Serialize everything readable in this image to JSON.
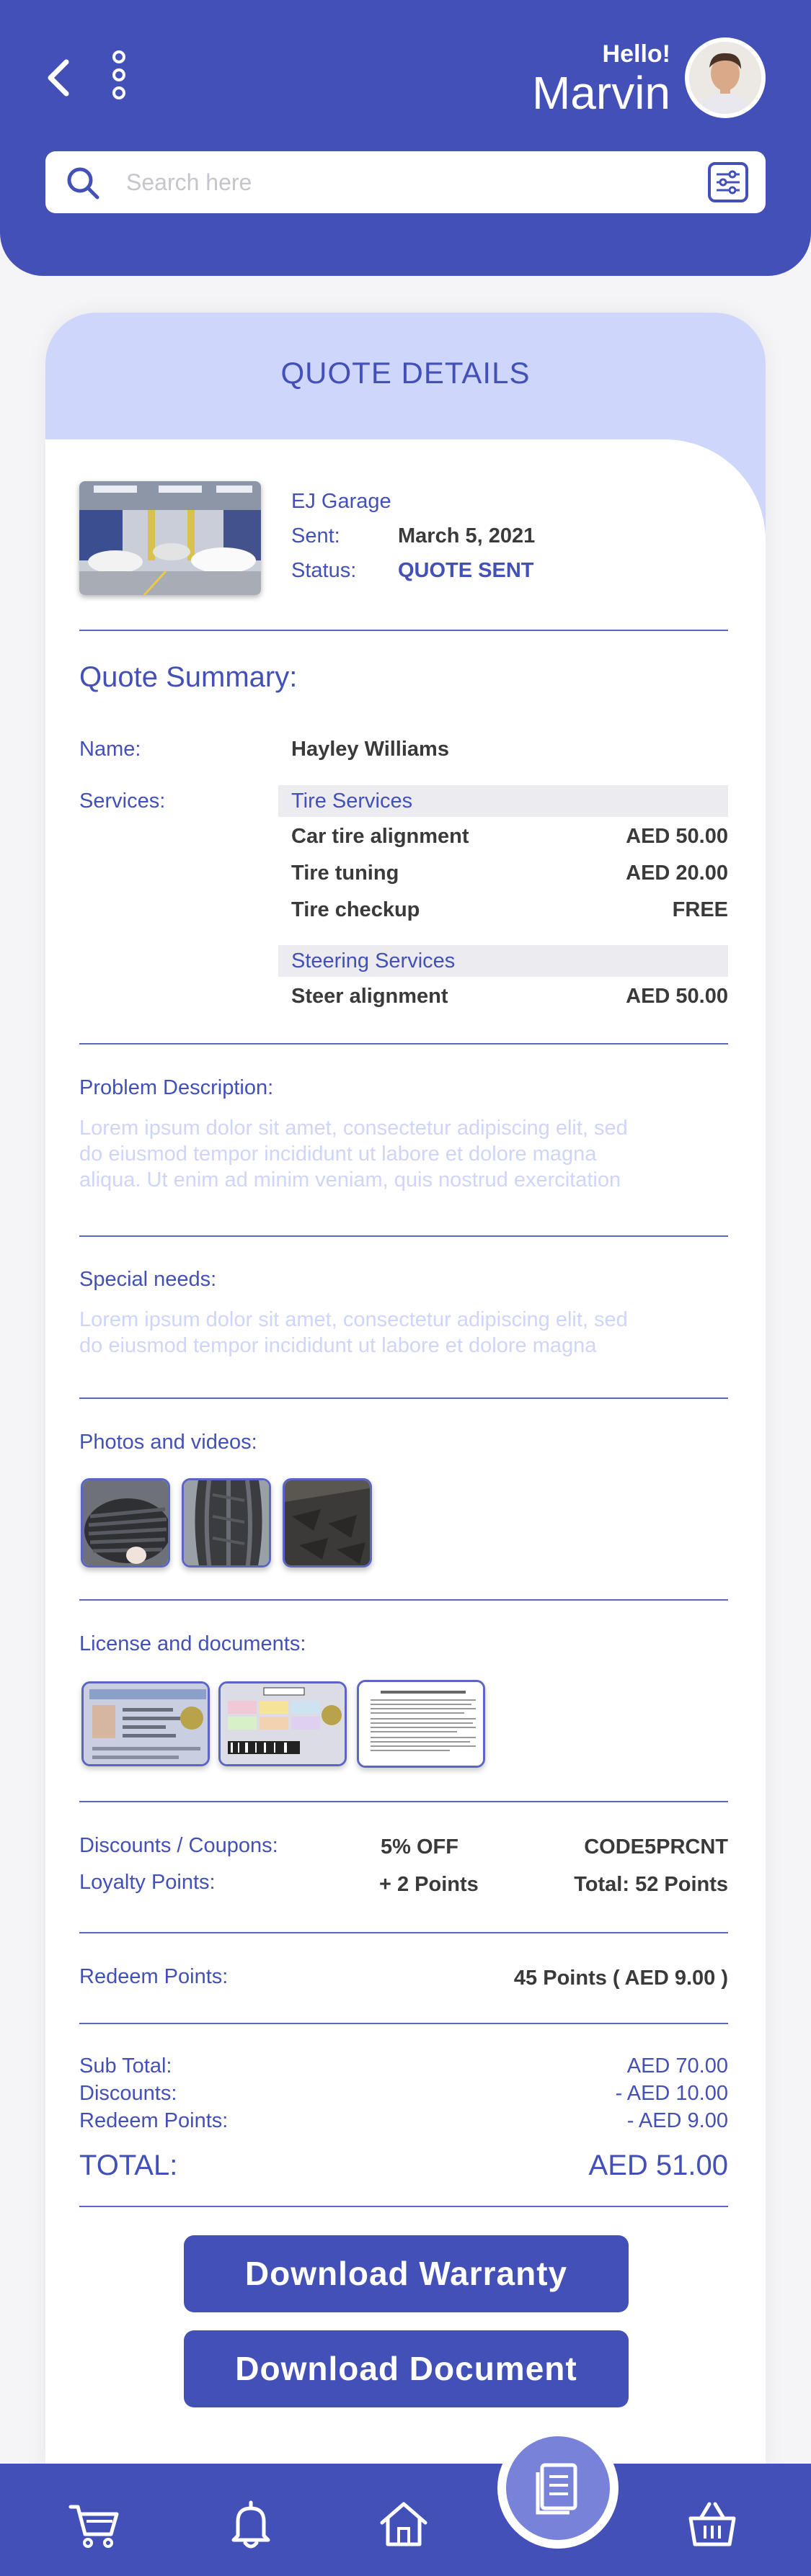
{
  "header": {
    "greeting": "Hello!",
    "user_name": "Marvin",
    "search_placeholder": "Search here"
  },
  "card": {
    "title": "QUOTE DETAILS",
    "garage_name": "EJ Garage",
    "sent_label": "Sent:",
    "sent_date": "March 5, 2021",
    "status_label": "Status:",
    "status_value": "QUOTE SENT"
  },
  "summary": {
    "title": "Quote Summary:",
    "name_label": "Name:",
    "name_value": "Hayley Williams",
    "services_label": "Services:",
    "groups": [
      {
        "title": "Tire Services",
        "items": [
          {
            "name": "Car tire alignment",
            "price": "AED 50.00"
          },
          {
            "name": "Tire tuning",
            "price": "AED 20.00"
          },
          {
            "name": "Tire checkup",
            "price": "FREE"
          }
        ]
      },
      {
        "title": "Steering Services",
        "items": [
          {
            "name": "Steer alignment",
            "price": "AED 50.00"
          }
        ]
      }
    ]
  },
  "problem": {
    "label": "Problem Description:",
    "lines": [
      "Lorem ipsum dolor sit amet, consectetur adipiscing elit, sed",
      "do eiusmod tempor incididunt ut labore et dolore magna",
      "aliqua. Ut enim ad minim veniam, quis nostrud exercitation"
    ]
  },
  "special": {
    "label": "Special needs:",
    "lines": [
      "Lorem ipsum dolor sit amet, consectetur adipiscing elit, sed",
      "do eiusmod tempor incididunt ut labore et dolore magna"
    ]
  },
  "photos_label": "Photos and videos:",
  "docs_label": "License and documents:",
  "discounts": {
    "label": "Discounts / Coupons:",
    "value": "5% OFF",
    "code": "CODE5PRCNT",
    "loyalty_label": "Loyalty Points:",
    "loyalty_value": "+ 2 Points",
    "loyalty_total": "Total:  52 Points"
  },
  "redeem": {
    "label": "Redeem Points:",
    "value": "45 Points ( AED 9.00 )"
  },
  "totals": {
    "subtotal_label": "Sub Total:",
    "subtotal_value": "AED 70.00",
    "discounts_label": "Discounts:",
    "discounts_value": "- AED 10.00",
    "redeem_label": "Redeem Points:",
    "redeem_value": "- AED 9.00",
    "total_label": "TOTAL:",
    "total_value": "AED 51.00"
  },
  "buttons": {
    "warranty": "Download Warranty",
    "document": "Download Document"
  },
  "colors": {
    "primary": "#4350b8",
    "accent_light": "#cfd6fb",
    "muted_text": "#cfd5f8"
  }
}
